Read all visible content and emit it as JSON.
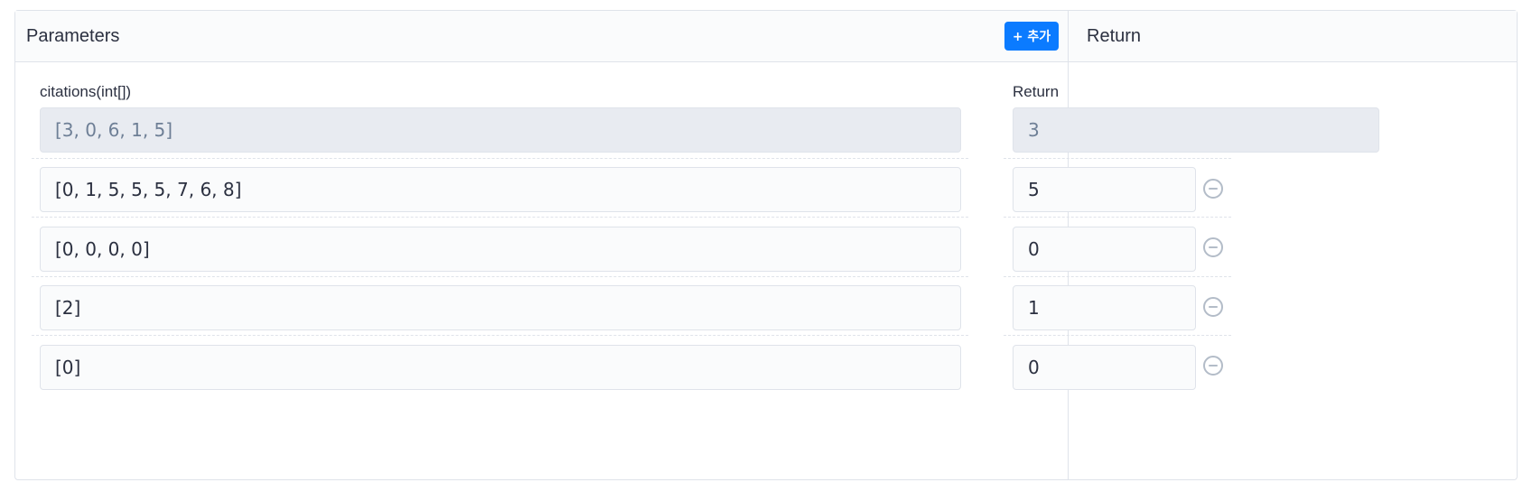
{
  "parameters": {
    "title": "Parameters",
    "add_button": "+ 추가",
    "param_label": "citations(int[])",
    "example_value": "[3, 0, 6, 1, 5]",
    "rows": [
      "[0, 1, 5, 5, 5, 7, 6, 8]",
      "[0, 0, 0, 0]",
      "[2]",
      "[0]"
    ]
  },
  "return": {
    "title": "Return",
    "label": "Return",
    "example_value": "3",
    "rows": [
      "5",
      "0",
      "1",
      "0"
    ]
  },
  "icons": {
    "remove": "minus-circle-icon"
  },
  "colors": {
    "accent": "#0b7bff",
    "example_bg": "#e8ebf1",
    "border": "#dfe3ea"
  }
}
